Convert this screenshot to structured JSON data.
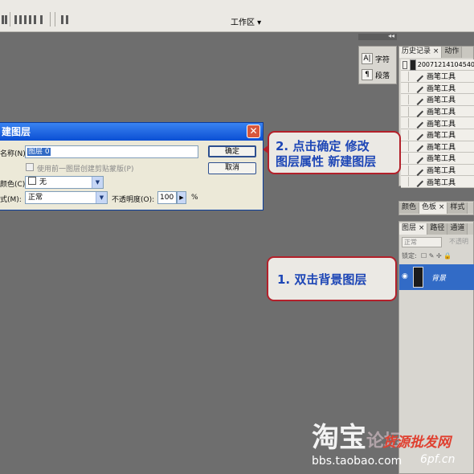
{
  "toolbar": {
    "workspace_label": "工作区 ▾"
  },
  "dock": {
    "character_label": "字符",
    "paragraph_label": "段落"
  },
  "history_panel": {
    "tabs": [
      "历史记录 ×",
      "动作"
    ],
    "snapshot_name": "20071214104540",
    "items": [
      "画笔工具",
      "画笔工具",
      "画笔工具",
      "画笔工具",
      "画笔工具",
      "画笔工具",
      "画笔工具",
      "画笔工具",
      "画笔工具",
      "画笔工具"
    ]
  },
  "color_panel": {
    "tabs": [
      "颜色",
      "色板 ×",
      "样式"
    ]
  },
  "layers_panel": {
    "tabs": [
      "图层 ×",
      "路径",
      "通道"
    ],
    "blend_mode": "正常",
    "opacity_label": "不透明",
    "lock_label": "锁定:",
    "layer_name": "背景"
  },
  "dialog": {
    "title": "建图层",
    "name_label": "名称(N):",
    "name_value": "图层 0",
    "clip_label": "使用前一图层创建剪贴蒙版(P)",
    "color_label": "颜色(C):",
    "color_value": "无",
    "mode_label": "式(M):",
    "mode_value": "正常",
    "opacity_label": "不透明度(O):",
    "opacity_value": "100",
    "opacity_unit": "%",
    "ok_label": "确定",
    "cancel_label": "取消"
  },
  "annotations": {
    "step2_line1": "2. 点击确定  修改",
    "step2_line2": "图层属性  新建图层",
    "step1": "1. 双击背景图层"
  },
  "watermark": {
    "logo_text": "淘宝",
    "logo_suffix": "论坛",
    "red_text": "货源批发网",
    "url": "bbs.taobao.com",
    "url2": "6pf.cn"
  },
  "colors": {
    "canvas_bg": "#6e6e6e",
    "callout_border": "#b3202a",
    "callout_text": "#1d46b6",
    "selection": "#316ac5"
  }
}
